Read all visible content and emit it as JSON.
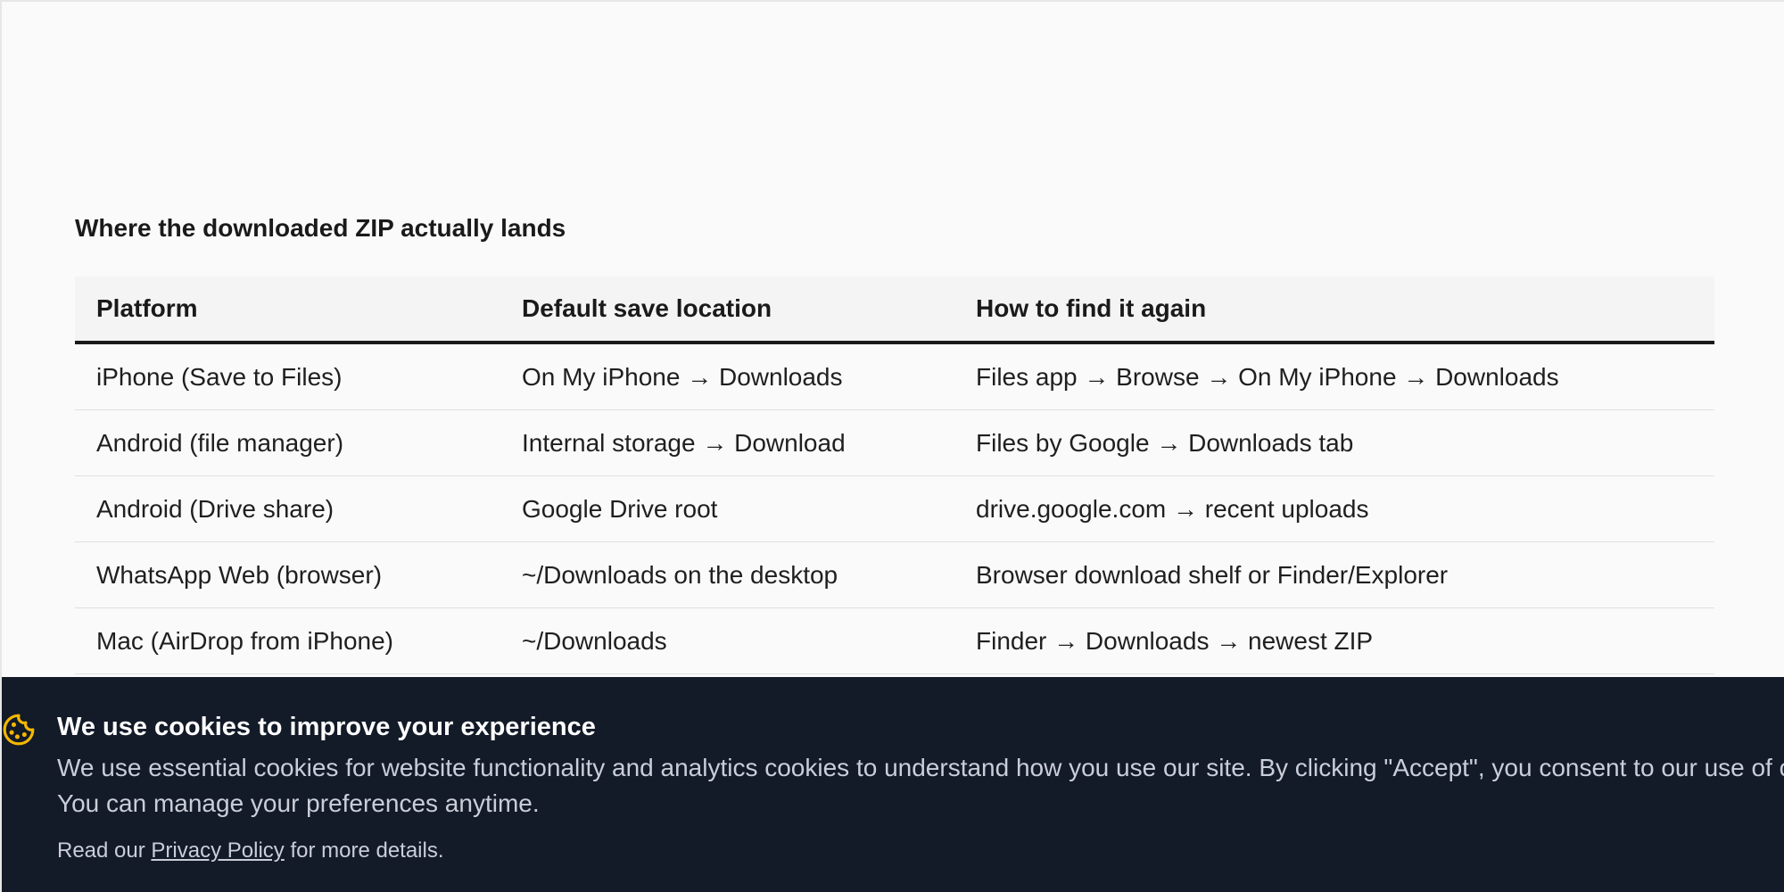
{
  "section": {
    "title": "Where the downloaded ZIP actually lands"
  },
  "table": {
    "headers": [
      "Platform",
      "Default save location",
      "How to find it again"
    ],
    "rows": [
      [
        "iPhone (Save to Files)",
        "On My iPhone → Downloads",
        "Files app → Browse → On My iPhone → Downloads"
      ],
      [
        "Android (file manager)",
        "Internal storage → Download",
        "Files by Google → Downloads tab"
      ],
      [
        "Android (Drive share)",
        "Google Drive root",
        "drive.google.com → recent uploads"
      ],
      [
        "WhatsApp Web (browser)",
        "~/Downloads on the desktop",
        "Browser download shelf or Finder/Explorer"
      ],
      [
        "Mac (AirDrop from iPhone)",
        "~/Downloads",
        "Finder → Downloads → newest ZIP"
      ]
    ]
  },
  "cookie_banner": {
    "icon": "cookie-icon",
    "title": "We use cookies to improve your experience",
    "text": "We use essential cookies for website functionality and analytics cookies to understand how you use our site. By clicking \"Accept\", you consent to our use of cookies. You can manage your preferences anytime.",
    "policy_prefix": "Read our ",
    "policy_link": "Privacy Policy",
    "policy_suffix": " for more details.",
    "accent_color": "#f5b700",
    "background_color": "#131a28"
  }
}
